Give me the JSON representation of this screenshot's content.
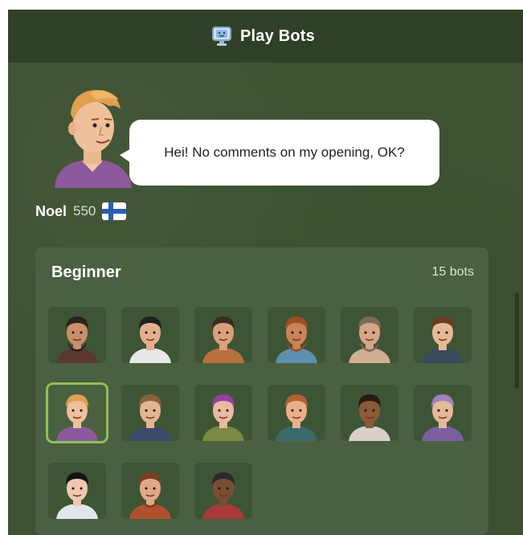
{
  "header": {
    "title": "Play Bots",
    "icon": "monitor-bot-icon"
  },
  "speech": {
    "text": "Hei! No comments on my opening, OK?"
  },
  "selected_bot": {
    "name": "Noel",
    "rating": "550",
    "flag": "finland-flag-icon"
  },
  "section": {
    "title": "Beginner",
    "count": "15 bots"
  },
  "bots": [
    {
      "id": "bot-1",
      "skin": "#c98e6a",
      "hair": "#2a221c",
      "shirt": "#5a3a30",
      "beard": true
    },
    {
      "id": "bot-2",
      "skin": "#e2b08e",
      "hair": "#1f1f1f",
      "shirt": "#e8e8e8",
      "beard": false
    },
    {
      "id": "bot-3",
      "skin": "#d9a07a",
      "hair": "#3a2c22",
      "shirt": "#b87040",
      "beard": false
    },
    {
      "id": "bot-4",
      "skin": "#c98358",
      "hair": "#9a4e24",
      "shirt": "#5e8fb0",
      "beard": true
    },
    {
      "id": "bot-5",
      "skin": "#d7a587",
      "hair": "#7c6a5c",
      "shirt": "#d0b090",
      "beard": true
    },
    {
      "id": "bot-6",
      "skin": "#e6b898",
      "hair": "#6a3a22",
      "shirt": "#3a4a5a",
      "beard": false
    },
    {
      "id": "bot-7",
      "skin": "#efc09a",
      "hair": "#e0a050",
      "shirt": "#8c5a9c",
      "beard": false,
      "selected": true
    },
    {
      "id": "bot-8",
      "skin": "#e4b592",
      "hair": "#8a6038",
      "shirt": "#3a4a6a",
      "beard": false
    },
    {
      "id": "bot-9",
      "skin": "#eab9a0",
      "hair": "#9a3e9a",
      "shirt": "#7a8a40",
      "beard": false
    },
    {
      "id": "bot-10",
      "skin": "#e8b08a",
      "hair": "#b0623a",
      "shirt": "#3a6a6a",
      "beard": false
    },
    {
      "id": "bot-11",
      "skin": "#8a5a3a",
      "hair": "#2a1a14",
      "shirt": "#d8d0c8",
      "beard": false
    },
    {
      "id": "bot-12",
      "skin": "#e4b898",
      "hair": "#a080c0",
      "shirt": "#7a60a0",
      "beard": false
    },
    {
      "id": "bot-13",
      "skin": "#f0c8b0",
      "hair": "#141418",
      "shirt": "#e0e6ea",
      "beard": false
    },
    {
      "id": "bot-14",
      "skin": "#e0a888",
      "hair": "#7a3e24",
      "shirt": "#b0502e",
      "beard": true
    },
    {
      "id": "bot-15",
      "skin": "#7a4e34",
      "hair": "#2a2a2a",
      "shirt": "#a83a3a",
      "beard": false
    }
  ],
  "colors": {
    "background": "#3e5232",
    "header": "#2f4027",
    "card": "#4a6040",
    "selected_border": "#8fbf5a"
  }
}
